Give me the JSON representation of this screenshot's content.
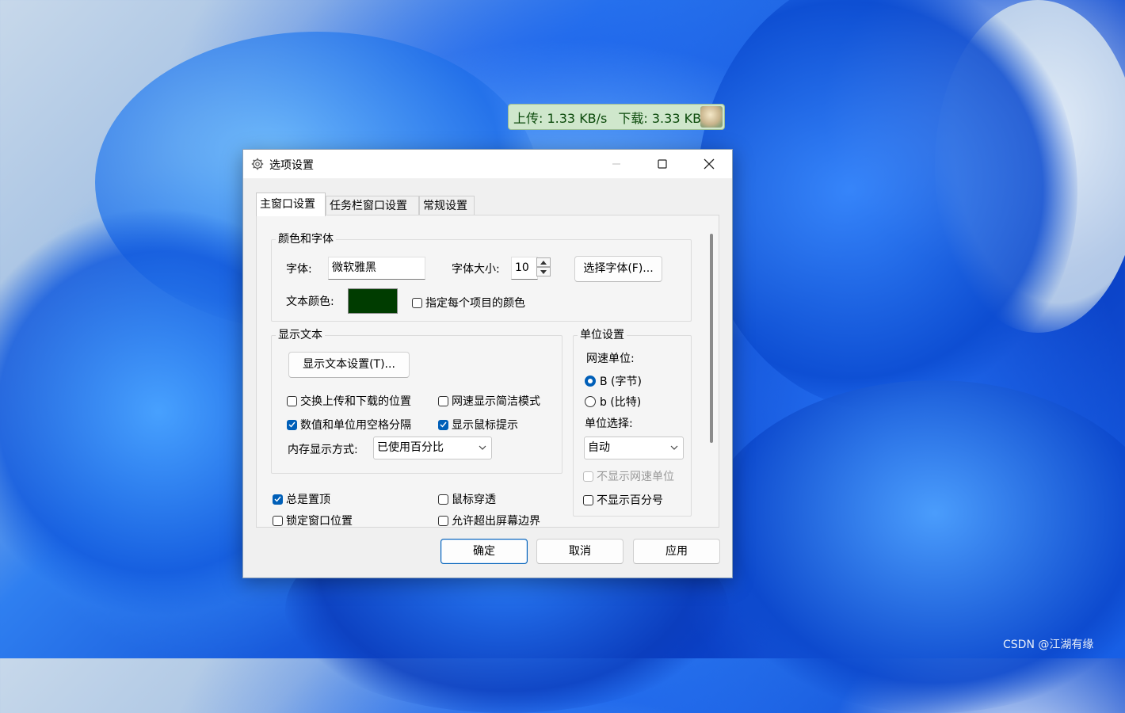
{
  "network_widget": {
    "upload": "上传: 1.33 KB/s",
    "download": "下载: 3.33 KB/s"
  },
  "dialog": {
    "title": "选项设置",
    "tabs": [
      {
        "label": "主窗口设置"
      },
      {
        "label": "任务栏窗口设置"
      },
      {
        "label": "常规设置"
      }
    ],
    "color_font": {
      "group_label": "颜色和字体",
      "font_label": "字体:",
      "font_value": "微软雅黑",
      "font_size_label": "字体大小:",
      "font_size_value": "10",
      "choose_font_button": "选择字体(F)...",
      "text_color_label": "文本颜色:",
      "text_color": "#003c00",
      "per_item_color_label": "指定每个项目的颜色",
      "per_item_color_checked": false
    },
    "display_text": {
      "group_label": "显示文本",
      "settings_button": "显示文本设置(T)...",
      "swap_label": "交换上传和下载的位置",
      "swap_checked": false,
      "simple_mode_label": "网速显示简洁模式",
      "simple_mode_checked": false,
      "space_sep_label": "数值和单位用空格分隔",
      "space_sep_checked": true,
      "tooltip_label": "显示鼠标提示",
      "tooltip_checked": true,
      "memory_mode_label": "内存显示方式:",
      "memory_mode_value": "已使用百分比"
    },
    "unit": {
      "group_label": "单位设置",
      "speed_unit_label": "网速单位:",
      "byte_label": "B (字节)",
      "bit_label": "b (比特)",
      "selected": "byte",
      "unit_select_label": "单位选择:",
      "unit_select_value": "自动",
      "hide_speed_unit_label": "不显示网速单位",
      "hide_percent_label": "不显示百分号"
    },
    "bottom_options": {
      "always_top_label": "总是置顶",
      "always_top_checked": true,
      "mouse_through_label": "鼠标穿透",
      "mouse_through_checked": false,
      "lock_position_label": "锁定窗口位置",
      "lock_position_checked": false,
      "allow_offscreen_label": "允许超出屏幕边界",
      "allow_offscreen_checked": false
    },
    "buttons": {
      "ok": "确定",
      "cancel": "取消",
      "apply": "应用"
    }
  },
  "watermark": "CSDN @江湖有缘"
}
